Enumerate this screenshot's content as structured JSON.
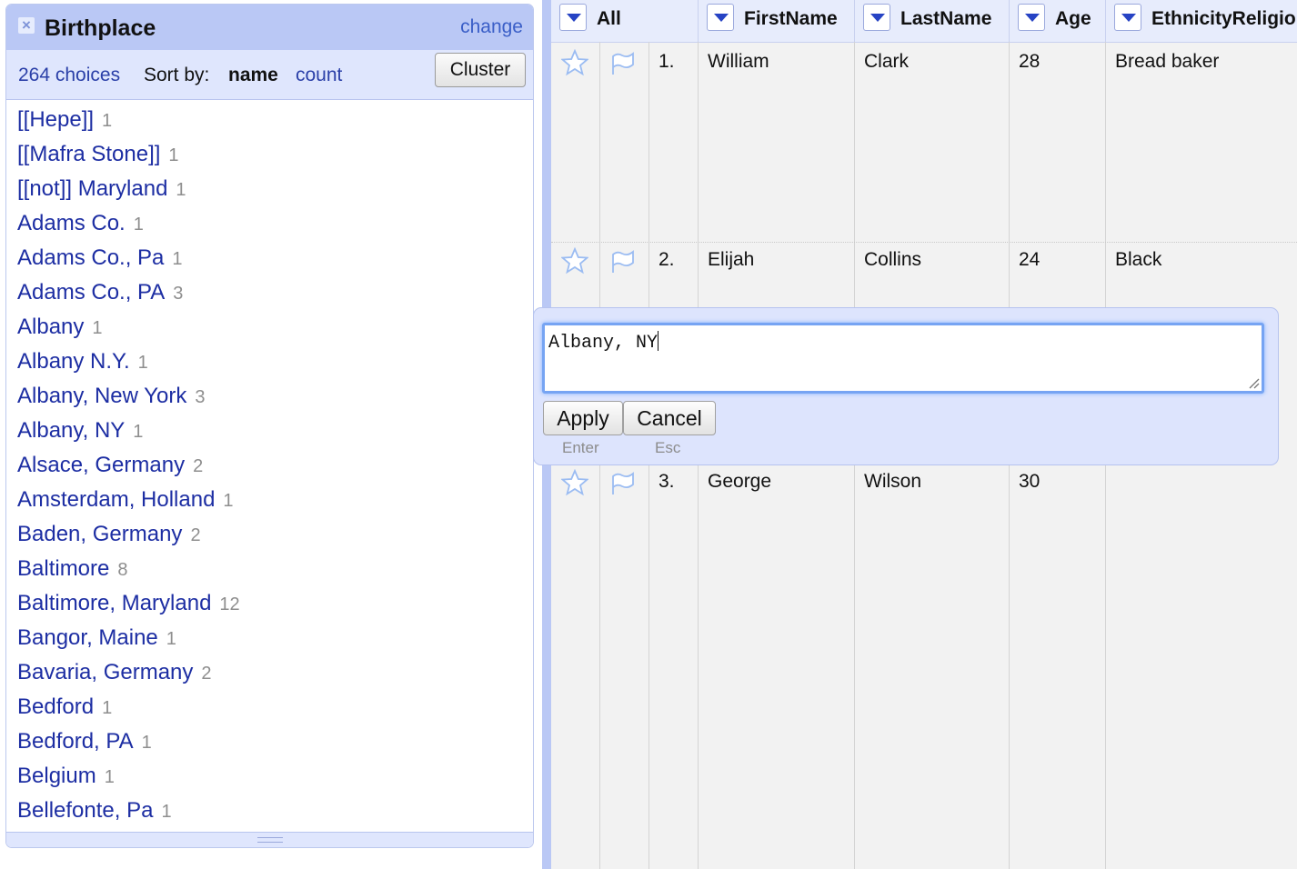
{
  "facet": {
    "title": "Birthplace",
    "change_label": "change",
    "choices_count": "264 choices",
    "sort_by_label": "Sort by:",
    "sort_name": "name",
    "sort_count": "count",
    "cluster_label": "Cluster",
    "choices": [
      {
        "label": "[[Hepe]]",
        "count": "1"
      },
      {
        "label": "[[Mafra Stone]]",
        "count": "1"
      },
      {
        "label": "[[not]] Maryland",
        "count": "1"
      },
      {
        "label": "Adams Co.",
        "count": "1"
      },
      {
        "label": "Adams Co., Pa",
        "count": "1"
      },
      {
        "label": "Adams Co., PA",
        "count": "3"
      },
      {
        "label": "Albany",
        "count": "1"
      },
      {
        "label": "Albany N.Y.",
        "count": "1"
      },
      {
        "label": "Albany, New York",
        "count": "3"
      },
      {
        "label": "Albany, NY",
        "count": "1"
      },
      {
        "label": "Alsace, Germany",
        "count": "2"
      },
      {
        "label": "Amsterdam, Holland",
        "count": "1"
      },
      {
        "label": "Baden, Germany",
        "count": "2"
      },
      {
        "label": "Baltimore",
        "count": "8"
      },
      {
        "label": "Baltimore, Maryland",
        "count": "12"
      },
      {
        "label": "Bangor, Maine",
        "count": "1"
      },
      {
        "label": "Bavaria, Germany",
        "count": "2"
      },
      {
        "label": "Bedford",
        "count": "1"
      },
      {
        "label": "Bedford, PA",
        "count": "1"
      },
      {
        "label": "Belgium",
        "count": "1"
      },
      {
        "label": "Bellefonte, Pa",
        "count": "1"
      }
    ]
  },
  "table": {
    "columns": [
      "All",
      "FirstName",
      "LastName",
      "Age",
      "EthnicityReligio"
    ],
    "rows": [
      {
        "index": "1.",
        "first": "William",
        "last": "Clark",
        "age": "28",
        "ethnicity": "Bread baker"
      },
      {
        "index": "2.",
        "first": "Elijah",
        "last": "Collins",
        "age": "24",
        "ethnicity": "Black"
      },
      {
        "index": "3.",
        "first": "George",
        "last": "Wilson",
        "age": "30",
        "ethnicity": ""
      }
    ]
  },
  "editor": {
    "value": "Albany, NY",
    "apply_label": "Apply",
    "apply_hint": "Enter",
    "cancel_label": "Cancel",
    "cancel_hint": "Esc"
  },
  "icons": {
    "star": "star-icon",
    "flag": "flag-icon",
    "close": "close-icon",
    "dropdown": "chevron-down-icon"
  },
  "colors": {
    "facet_header": "#bac8f5",
    "facet_controls": "#dfe6fd",
    "link": "#1d2ea3",
    "column_header": "#e7ecfc",
    "dropdown_arrow": "#2643c4",
    "focus_ring": "#76a4f3"
  }
}
